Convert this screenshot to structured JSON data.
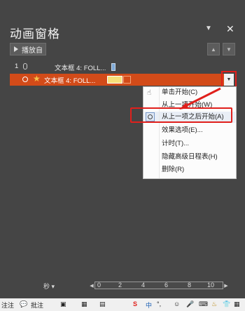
{
  "pane": {
    "title": "动画窗格",
    "dropdown_icon": "triangle-down-icon",
    "close_icon": "close-icon",
    "play_button": "播放自",
    "move_up_icon": "arrow-up-icon",
    "move_down_icon": "arrow-down-icon"
  },
  "animations": [
    {
      "number": "1",
      "trigger_icon": "mouse-icon",
      "name": "文本框 4: FOLL...",
      "selected": false
    },
    {
      "number": "",
      "trigger_icon": "clock-icon",
      "effect_icon": "star-icon",
      "name": "文本框 4: FOLL...",
      "selected": true
    }
  ],
  "context_menu": {
    "items": [
      {
        "label": "单击开始(C)",
        "icon": "hand-click-icon"
      },
      {
        "label": "从上一项开始(W)",
        "icon": ""
      },
      {
        "label": "从上一项之后开始(A)",
        "icon": "clock-icon",
        "highlighted": true
      },
      {
        "label": "效果选项(E)...",
        "icon": ""
      },
      {
        "label": "计时(T)...",
        "icon": ""
      },
      {
        "label": "隐藏高级日程表(H)",
        "icon": ""
      },
      {
        "label": "删除(R)",
        "icon": ""
      }
    ]
  },
  "timeline": {
    "unit_label": "秒 ▾",
    "ticks": [
      "0",
      "2",
      "4",
      "6",
      "8",
      "10"
    ]
  },
  "statusbar": {
    "left_label": "注注",
    "comment_label": "批注",
    "ime_items": [
      "中",
      "°,",
      "☺",
      "🎤",
      "⌨"
    ]
  },
  "colors": {
    "pane_bg": "#454545",
    "selected_row": "#d24b19",
    "annotation_red": "#e0201c"
  }
}
